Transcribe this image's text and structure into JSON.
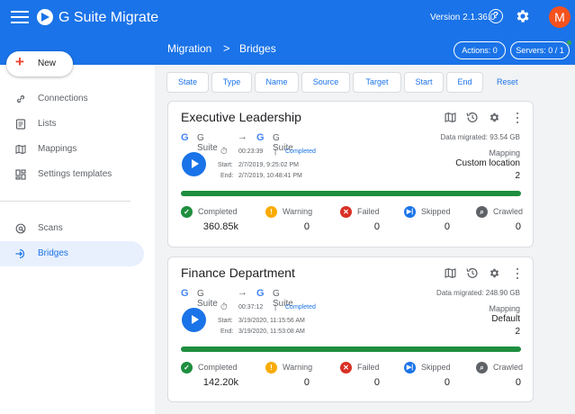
{
  "app": {
    "title": "G Suite Migrate",
    "version": "Version 2.1.36.0",
    "avatar_initial": "M",
    "brand_color": "#1a73e8"
  },
  "header": {
    "breadcrumb": [
      "Migration",
      "Bridges"
    ],
    "breadcrumb_separator": ">",
    "actions_label": "Actions: 0",
    "servers_label": "Servers: 0 / 1",
    "server_status_color": "#34a853"
  },
  "sidebar": {
    "new_label": "New",
    "items": [
      {
        "label": "Connections",
        "icon": "link-icon"
      },
      {
        "label": "Lists",
        "icon": "list-icon"
      },
      {
        "label": "Mappings",
        "icon": "map-icon"
      },
      {
        "label": "Settings templates",
        "icon": "template-icon"
      },
      {
        "label": "Scans",
        "icon": "scan-icon"
      },
      {
        "label": "Bridges",
        "icon": "bridge-icon",
        "active": true
      }
    ]
  },
  "filters": {
    "columns": [
      "State",
      "Type",
      "Name",
      "Source",
      "Target",
      "Start",
      "End"
    ],
    "reset_label": "Reset"
  },
  "bridges": [
    {
      "name": "Executive Leadership",
      "source": "G Suite",
      "target": "G Suite",
      "arrow": "→",
      "data_migrated": "Data migrated: 93.54 GB",
      "duration": "00:23:39",
      "separator": "|",
      "status": "Completed",
      "start_label": "Start:",
      "start": "2/7/2019, 9:25:02 PM",
      "end_label": "End:",
      "end": "2/7/2019, 10:48:41 PM",
      "mapping_label": "Mapping",
      "mapping": "Custom location",
      "mapping_count": "2",
      "progress": 1.0,
      "stats": [
        {
          "label": "Completed",
          "value": "360.85k",
          "icon": "check-circle-icon",
          "color": "#1e8e3e"
        },
        {
          "label": "Warning",
          "value": "0",
          "icon": "warning-icon",
          "color": "#f9ab00"
        },
        {
          "label": "Failed",
          "value": "0",
          "icon": "failed-icon",
          "color": "#d93025"
        },
        {
          "label": "Skipped",
          "value": "0",
          "icon": "skipped-icon",
          "color": "#1a73e8"
        },
        {
          "label": "Crawled",
          "value": "0",
          "icon": "crawled-icon",
          "color": "#5f6368"
        }
      ]
    },
    {
      "name": "Finance Department",
      "source": "G Suite",
      "target": "G Suite",
      "arrow": "→",
      "data_migrated": "Data migrated: 248.90 GB",
      "duration": "00:37:12",
      "separator": "|",
      "status": "Completed",
      "start_label": "Start:",
      "start": "3/19/2020, 11:15:56 AM",
      "end_label": "End:",
      "end": "3/19/2020, 11:53:08 AM",
      "mapping_label": "Mapping",
      "mapping": "Default",
      "mapping_count": "2",
      "progress": 1.0,
      "stats": [
        {
          "label": "Completed",
          "value": "142.20k",
          "icon": "check-circle-icon",
          "color": "#1e8e3e"
        },
        {
          "label": "Warning",
          "value": "0",
          "icon": "warning-icon",
          "color": "#f9ab00"
        },
        {
          "label": "Failed",
          "value": "0",
          "icon": "failed-icon",
          "color": "#d93025"
        },
        {
          "label": "Skipped",
          "value": "0",
          "icon": "skipped-icon",
          "color": "#1a73e8"
        },
        {
          "label": "Crawled",
          "value": "0",
          "icon": "crawled-icon",
          "color": "#5f6368"
        }
      ]
    }
  ]
}
